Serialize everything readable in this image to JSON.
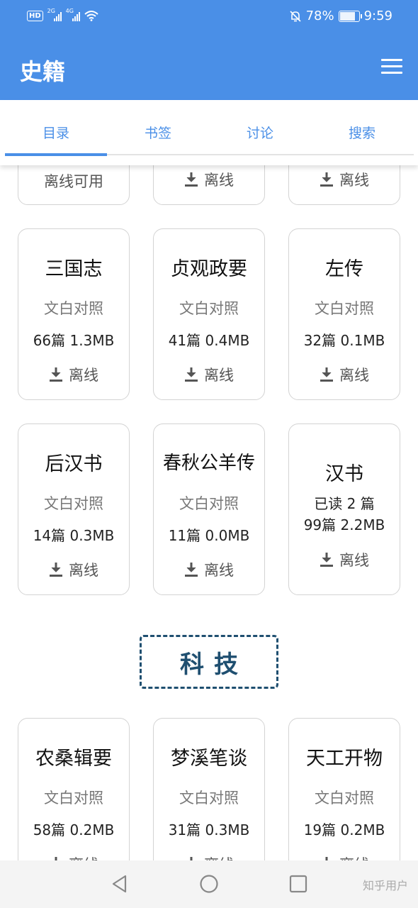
{
  "status": {
    "hd": "HD",
    "sim1": "2G",
    "sim2": "4G",
    "battery": "78%",
    "time": "9:59"
  },
  "app": {
    "title": "史籍",
    "menu_icon": "hamburger-menu-icon"
  },
  "tabs": [
    {
      "label": "目录",
      "active": true
    },
    {
      "label": "书签",
      "active": false
    },
    {
      "label": "讨论",
      "active": false
    },
    {
      "label": "搜索",
      "active": false
    }
  ],
  "partial_row": [
    {
      "text": "离线可用"
    },
    {
      "text": "离线"
    },
    {
      "text": "离线"
    }
  ],
  "books_row1": [
    {
      "title": "三国志",
      "sub": "文白对照",
      "size": "66篇 1.3MB",
      "action": "离线"
    },
    {
      "title": "贞观政要",
      "sub": "文白对照",
      "size": "41篇 0.4MB",
      "action": "离线"
    },
    {
      "title": "左传",
      "sub": "文白对照",
      "size": "32篇 0.1MB",
      "action": "离线"
    }
  ],
  "books_row2": [
    {
      "title": "后汉书",
      "sub": "文白对照",
      "size": "14篇 0.3MB",
      "action": "离线"
    },
    {
      "title": "春秋公羊传",
      "sub": "文白对照",
      "size": "11篇 0.0MB",
      "action": "离线"
    },
    {
      "title": "汉书",
      "read": "已读 2 篇",
      "size": "99篇 2.2MB",
      "action": "离线"
    }
  ],
  "section": {
    "title": "科技"
  },
  "books_row3": [
    {
      "title": "农桑辑要",
      "sub": "文白对照",
      "size": "58篇 0.2MB",
      "action": "离线"
    },
    {
      "title": "梦溪笔谈",
      "sub": "文白对照",
      "size": "31篇 0.3MB",
      "action": "离线"
    },
    {
      "title": "天工开物",
      "sub": "文白对照",
      "size": "19篇 0.2MB",
      "action": "离线"
    }
  ],
  "watermark": "知乎用户",
  "colors": {
    "primary": "#4a8fe7",
    "section": "#1f4f70"
  }
}
